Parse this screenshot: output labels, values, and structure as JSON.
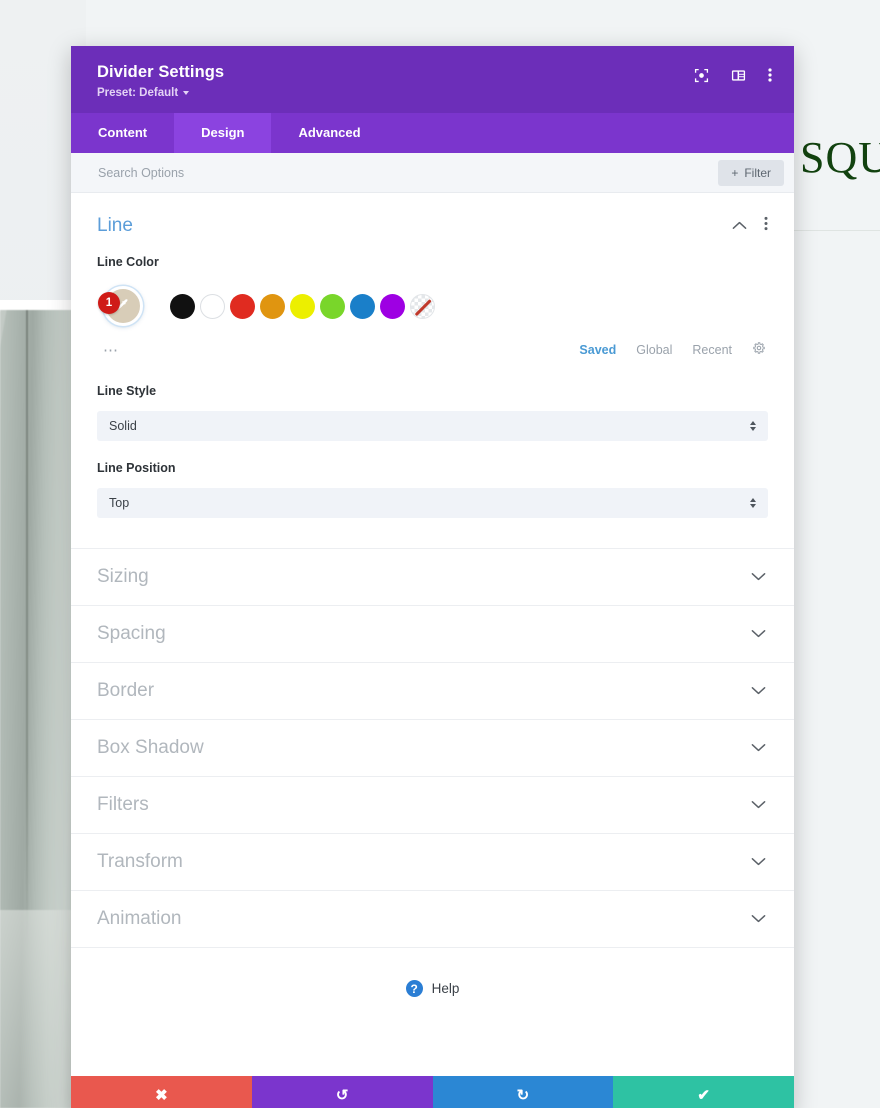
{
  "background": {
    "wordmark": "SQU",
    "photo_alt": "blurred-window-photo"
  },
  "header": {
    "title": "Divider Settings",
    "preset_label": "Preset: Default",
    "icons": [
      {
        "name": "focus-target-icon",
        "label": "Focus"
      },
      {
        "name": "layout-panel-icon",
        "label": "Layout"
      },
      {
        "name": "more-vertical-icon",
        "label": "More"
      }
    ]
  },
  "tabs": [
    {
      "label": "Content",
      "active": false
    },
    {
      "label": "Design",
      "active": true
    },
    {
      "label": "Advanced",
      "active": false
    }
  ],
  "search": {
    "placeholder": "Search Options",
    "value": "",
    "filter_label": "Filter",
    "filter_plus": "+"
  },
  "line_section": {
    "title": "Line",
    "collapse_icon": "chevron-up-icon",
    "menu_icon": "more-vertical-icon",
    "color_label": "Line Color",
    "selected_swatch": {
      "color": "#d8cdb8",
      "badge": "1",
      "badge_color": "#cf1b17",
      "icon": "eyedropper-icon"
    },
    "swatches": [
      {
        "name": "black",
        "color": "#111111"
      },
      {
        "name": "white",
        "color": "#ffffff"
      },
      {
        "name": "red",
        "color": "#e02b20"
      },
      {
        "name": "orange",
        "color": "#e09510"
      },
      {
        "name": "yellow",
        "color": "#ecef00"
      },
      {
        "name": "green",
        "color": "#79d62a"
      },
      {
        "name": "blue",
        "color": "#1a7fc9"
      },
      {
        "name": "purple",
        "color": "#9e00e3"
      },
      {
        "name": "none",
        "color": "transparent"
      }
    ],
    "palette_menu_icon": "more-horizontal-icon",
    "palette_tabs": [
      {
        "label": "Saved",
        "active": true
      },
      {
        "label": "Global",
        "active": false
      },
      {
        "label": "Recent",
        "active": false
      }
    ],
    "palette_settings_icon": "gear-icon",
    "line_style": {
      "label": "Line Style",
      "value": "Solid"
    },
    "line_position": {
      "label": "Line Position",
      "value": "Top"
    }
  },
  "accordion": [
    {
      "label": "Sizing",
      "icon": "chevron-down-icon"
    },
    {
      "label": "Spacing",
      "icon": "chevron-down-icon"
    },
    {
      "label": "Border",
      "icon": "chevron-down-icon"
    },
    {
      "label": "Box Shadow",
      "icon": "chevron-down-icon"
    },
    {
      "label": "Filters",
      "icon": "chevron-down-icon"
    },
    {
      "label": "Transform",
      "icon": "chevron-down-icon"
    },
    {
      "label": "Animation",
      "icon": "chevron-down-icon"
    }
  ],
  "help": {
    "label": "Help",
    "mark": "?"
  },
  "footer": [
    {
      "name": "cancel",
      "glyph": "✖",
      "color": "#e9584e"
    },
    {
      "name": "undo",
      "glyph": "↺",
      "color": "#7b35cd"
    },
    {
      "name": "redo",
      "glyph": "↻",
      "color": "#2b87d4"
    },
    {
      "name": "save",
      "glyph": "✔",
      "color": "#2ec2a3"
    }
  ]
}
